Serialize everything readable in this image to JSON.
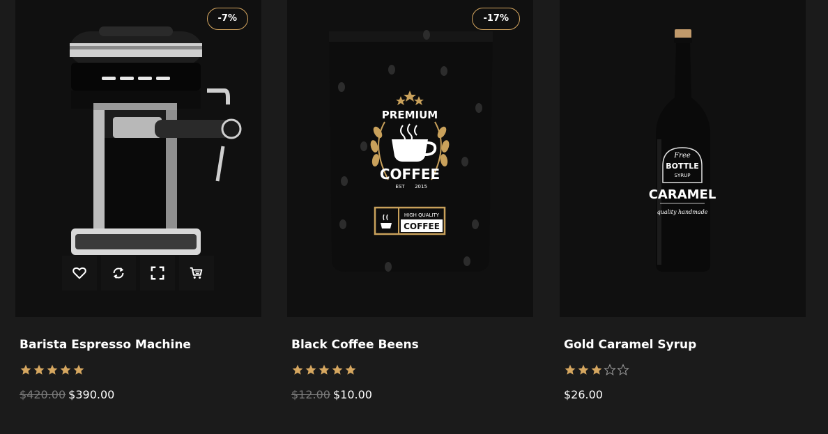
{
  "colors": {
    "background": "#1b1b1b",
    "card": "#101010",
    "accent": "#d6a760",
    "old_price": "#7a7a7a"
  },
  "action_icons": [
    "heart-icon",
    "refresh-icon",
    "fullscreen-icon",
    "cart-icon"
  ],
  "products": [
    {
      "badge": "-7%",
      "title": "Barista Espresso Machine",
      "rating": 5,
      "old_price": "$420.00",
      "price": "$390.00",
      "image": "espresso-machine"
    },
    {
      "badge": "-17%",
      "title": "Black Coffee Beens",
      "rating": 5,
      "old_price": "$12.00",
      "price": "$10.00",
      "image": "coffee-bag",
      "package_text": {
        "arc": "PREMIUM",
        "name": "COFFEE",
        "est": "EST",
        "year": "2015",
        "quality": "HIGH QUALITY",
        "quality_name": "COFFEE"
      }
    },
    {
      "badge": "",
      "title": "Gold Caramel Syrup",
      "rating": 3,
      "old_price": "",
      "price": "$26.00",
      "image": "syrup-bottle",
      "label_text": {
        "top": "Free",
        "mid": "BOTTLE",
        "sub": "SYRUP",
        "name": "CARAMEL",
        "tagline": "quality handmade"
      }
    }
  ]
}
